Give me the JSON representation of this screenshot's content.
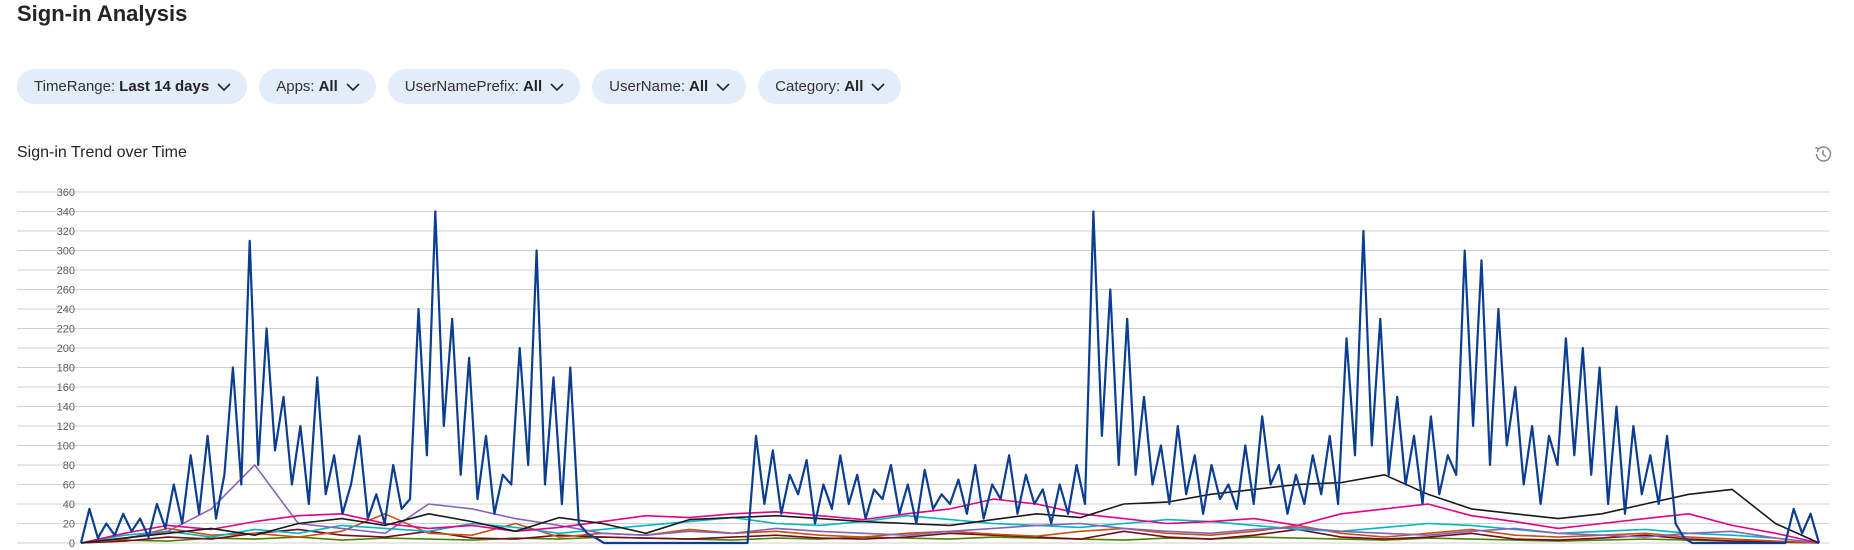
{
  "page": {
    "title": "Sign-in Analysis"
  },
  "filters": [
    {
      "label": "TimeRange",
      "value": "Last 14 days"
    },
    {
      "label": "Apps",
      "value": "All"
    },
    {
      "label": "UserNamePrefix",
      "value": "All"
    },
    {
      "label": "UserName",
      "value": "All"
    },
    {
      "label": "Category",
      "value": "All"
    }
  ],
  "section": {
    "title": "Sign-in Trend over Time"
  },
  "icons": {
    "history": "history-icon",
    "chevron": "chevron-down-icon"
  },
  "chart_data": {
    "type": "line",
    "ylim": [
      0,
      360
    ],
    "yticks": [
      0,
      20,
      40,
      60,
      80,
      100,
      120,
      140,
      160,
      180,
      200,
      220,
      240,
      260,
      280,
      300,
      320,
      340,
      360
    ],
    "grid": true,
    "series": [
      {
        "color": "#0b3d91",
        "values": [
          0,
          35,
          5,
          20,
          8,
          30,
          12,
          25,
          6,
          40,
          15,
          60,
          20,
          90,
          30,
          110,
          25,
          70,
          180,
          60,
          310,
          80,
          220,
          95,
          150,
          60,
          120,
          40,
          170,
          50,
          90,
          30,
          60,
          110,
          25,
          50,
          20,
          80,
          35,
          45,
          240,
          90,
          340,
          120,
          230,
          70,
          190,
          45,
          110,
          30,
          70,
          60,
          200,
          80,
          300,
          60,
          170,
          40,
          180,
          20,
          10,
          5,
          0,
          0,
          0,
          0,
          0,
          0,
          0,
          0,
          0,
          0,
          0,
          0,
          0,
          0,
          0,
          0,
          0,
          0,
          110,
          40,
          95,
          30,
          70,
          50,
          85,
          20,
          60,
          35,
          90,
          40,
          70,
          25,
          55,
          45,
          80,
          30,
          60,
          20,
          75,
          35,
          50,
          40,
          65,
          30,
          80,
          25,
          60,
          45,
          90,
          30,
          70,
          40,
          55,
          20,
          60,
          30,
          80,
          40,
          340,
          110,
          260,
          80,
          230,
          70,
          150,
          60,
          100,
          40,
          120,
          50,
          90,
          30,
          80,
          45,
          60,
          35,
          100,
          40,
          130,
          60,
          80,
          30,
          70,
          40,
          90,
          50,
          110,
          40,
          210,
          90,
          320,
          100,
          230,
          70,
          150,
          60,
          110,
          40,
          130,
          50,
          90,
          70,
          300,
          120,
          290,
          80,
          240,
          100,
          160,
          60,
          120,
          40,
          110,
          80,
          210,
          90,
          200,
          70,
          180,
          40,
          140,
          30,
          120,
          50,
          90,
          40,
          110,
          20,
          5,
          0,
          0,
          0,
          0,
          0,
          0,
          0,
          0,
          0,
          0,
          0,
          0,
          35,
          10,
          30,
          0
        ]
      },
      {
        "color": "#1a1a1a",
        "values": [
          0,
          5,
          10,
          15,
          8,
          20,
          25,
          18,
          30,
          22,
          12,
          26,
          20,
          10,
          24,
          26,
          28,
          25,
          22,
          20,
          18,
          24,
          30,
          26,
          40,
          42,
          50,
          55,
          60,
          62,
          70,
          50,
          35,
          30,
          25,
          30,
          40,
          50,
          55,
          20,
          0
        ]
      },
      {
        "color": "#e3008c",
        "values": [
          0,
          10,
          18,
          14,
          22,
          28,
          30,
          20,
          15,
          18,
          12,
          16,
          22,
          28,
          26,
          30,
          32,
          28,
          24,
          30,
          35,
          45,
          40,
          30,
          25,
          20,
          22,
          25,
          18,
          30,
          35,
          40,
          28,
          22,
          15,
          20,
          25,
          30,
          18,
          10,
          0
        ]
      },
      {
        "color": "#8764b8",
        "values": [
          0,
          5,
          12,
          35,
          80,
          20,
          15,
          10,
          40,
          35,
          25,
          18,
          10,
          8,
          12,
          10,
          15,
          12,
          10,
          8,
          12,
          15,
          18,
          20,
          15,
          12,
          10,
          14,
          16,
          12,
          10,
          8,
          12,
          15,
          10,
          8,
          6,
          10,
          12,
          5,
          0
        ]
      },
      {
        "color": "#00b7c3",
        "values": [
          0,
          8,
          12,
          6,
          14,
          10,
          18,
          15,
          12,
          20,
          16,
          10,
          14,
          18,
          22,
          26,
          20,
          18,
          22,
          28,
          24,
          20,
          18,
          16,
          20,
          24,
          22,
          18,
          14,
          12,
          16,
          20,
          18,
          14,
          10,
          12,
          14,
          10,
          8,
          5,
          0
        ]
      },
      {
        "color": "#ca5010",
        "values": [
          0,
          4,
          15,
          8,
          10,
          6,
          12,
          30,
          10,
          8,
          20,
          6,
          10,
          8,
          14,
          10,
          12,
          8,
          6,
          10,
          12,
          9,
          7,
          12,
          15,
          10,
          8,
          12,
          18,
          10,
          6,
          10,
          14,
          8,
          6,
          8,
          10,
          6,
          4,
          2,
          0
        ]
      },
      {
        "color": "#750b1c",
        "values": [
          0,
          2,
          6,
          4,
          10,
          14,
          8,
          6,
          12,
          5,
          4,
          8,
          6,
          5,
          4,
          6,
          8,
          5,
          4,
          6,
          10,
          8,
          6,
          4,
          12,
          6,
          4,
          8,
          14,
          6,
          4,
          6,
          10,
          4,
          3,
          5,
          8,
          4,
          2,
          1,
          0
        ]
      },
      {
        "color": "#498205",
        "values": [
          0,
          3,
          2,
          5,
          4,
          6,
          3,
          5,
          4,
          3,
          5,
          4,
          6,
          5,
          4,
          3,
          5,
          4,
          6,
          5,
          4,
          6,
          5,
          4,
          3,
          5,
          4,
          6,
          5,
          4,
          3,
          5,
          4,
          3,
          2,
          3,
          4,
          3,
          2,
          1,
          0
        ]
      }
    ]
  }
}
